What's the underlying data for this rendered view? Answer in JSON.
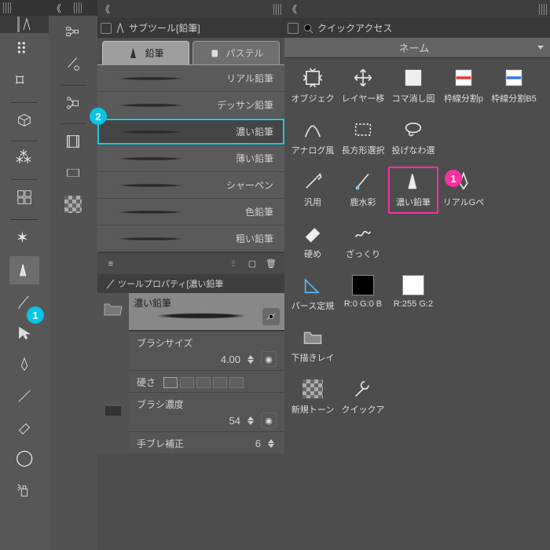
{
  "toolbar_icons": [
    "cursor",
    "hand",
    "gear",
    "cube",
    "scatter",
    "film",
    "strip",
    "pattern",
    "wand",
    "pencil",
    "brush",
    "pointer",
    "pen",
    "line",
    "erase",
    "paint",
    "spray"
  ],
  "subtool": {
    "panel_title": "サブツール[鉛筆]",
    "tabs": [
      {
        "label": "鉛筆",
        "selected": true
      },
      {
        "label": "パステル",
        "selected": false
      }
    ],
    "brushes": [
      {
        "label": "リアル鉛筆"
      },
      {
        "label": "デッサン鉛筆"
      },
      {
        "label": "濃い鉛筆",
        "selected": true
      },
      {
        "label": "薄い鉛筆"
      },
      {
        "label": "シャーペン"
      },
      {
        "label": "色鉛筆"
      },
      {
        "label": "粗い鉛筆"
      }
    ],
    "footer_icons": [
      "menu",
      "swap",
      "new",
      "trash"
    ]
  },
  "props": {
    "panel_title": "ツールプロパティ[濃い鉛筆",
    "preview_label": "濃い鉛筆",
    "rows": [
      {
        "label": "ブラシサイズ",
        "value": "4.00",
        "show_boxes": false,
        "show_slider": true,
        "show_updown": true,
        "end": "circle"
      },
      {
        "label": "硬さ",
        "value": "",
        "show_boxes": true,
        "show_slider": false,
        "show_updown": false,
        "end": ""
      },
      {
        "label": "ブラシ濃度",
        "value": "54",
        "show_boxes": false,
        "show_slider": true,
        "show_updown": true,
        "end": "circle"
      },
      {
        "label": "手ブレ補正",
        "value": "6",
        "show_boxes": false,
        "show_slider": false,
        "show_updown": true,
        "end": ""
      }
    ]
  },
  "quick": {
    "panel_title": "クイックアクセス",
    "tab_name": "ネーム",
    "cells": [
      {
        "label": "オブジェク",
        "icon": "object"
      },
      {
        "label": "レイヤー移",
        "icon": "move"
      },
      {
        "label": "コマ消し囮",
        "icon": "eraseframe"
      },
      {
        "label": "枠線分割p",
        "icon": "divider-red"
      },
      {
        "label": "枠線分割B5",
        "icon": "divider-blue"
      },
      {
        "label": "アナログ風",
        "icon": "analog"
      },
      {
        "label": "長方形選択",
        "icon": "rectsel"
      },
      {
        "label": "投げなわ選",
        "icon": "lasso"
      },
      {
        "label": "汎用",
        "icon": "pen-diag"
      },
      {
        "label": "鹿水彩",
        "icon": "brush-water"
      },
      {
        "label": "濃い鉛筆",
        "icon": "pencil-ico",
        "highlight": true
      },
      {
        "label": "リアルGペ",
        "icon": "gpen"
      },
      {
        "label": "硬め",
        "icon": "eraser"
      },
      {
        "label": "ざっくり",
        "icon": "rough"
      },
      {
        "label": "パース定規",
        "icon": "ruler"
      },
      {
        "label": "R:0 G:0 B",
        "icon": "black-sw"
      },
      {
        "label": "R:255 G:2",
        "icon": "white-sw"
      },
      {
        "label": "下描きレイ",
        "icon": "folder"
      },
      {
        "label": "新規トーン",
        "icon": "tone"
      },
      {
        "label": "クイックア",
        "icon": "wrench"
      }
    ]
  },
  "callouts": {
    "cyan1": "1",
    "cyan2": "2",
    "pink1": "1"
  }
}
